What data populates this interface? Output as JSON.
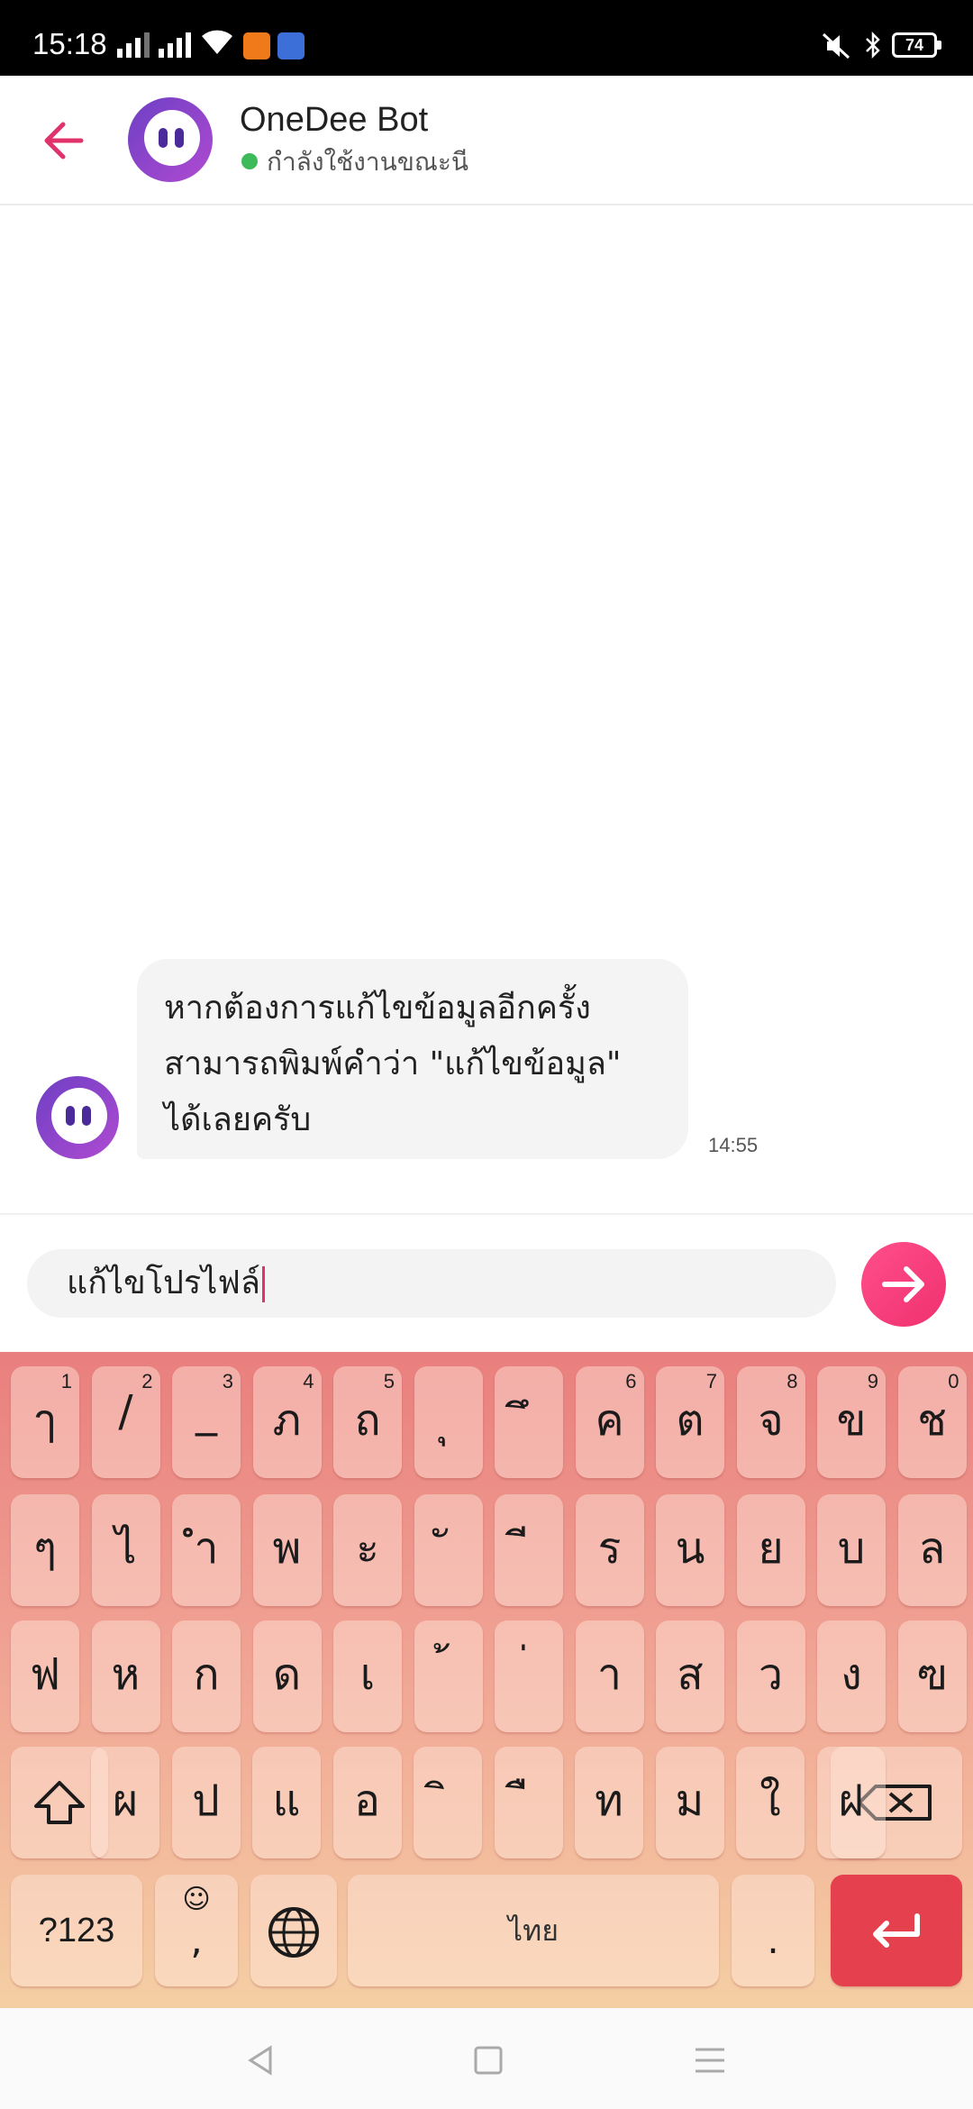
{
  "status_bar": {
    "time": "15:18",
    "battery": "74",
    "icons": [
      "signal-icon",
      "signal-icon",
      "wifi-icon",
      "app-notification-icon",
      "app-notification-icon",
      "mute-icon",
      "bluetooth-icon",
      "battery-icon"
    ]
  },
  "header": {
    "bot_name": "OneDee Bot",
    "status_text": "กำลังใช้งานขณะนี",
    "status_color": "#3dbb5a",
    "accent": "#e0336b"
  },
  "chat": {
    "messages": [
      {
        "lines": [
          "หากต้องการแก้ไขข้อมูลอีกครั้ง",
          "สามารถพิมพ์คำว่า \"แก้ไขข้อมูล\"",
          "ได้เลยครับ"
        ],
        "time": "14:55"
      }
    ]
  },
  "input": {
    "value": "แก้ไขโปรไฟล์"
  },
  "keyboard": {
    "row1": [
      {
        "key": "ๅ",
        "hint": "1"
      },
      {
        "key": "/",
        "hint": "2"
      },
      {
        "key": "_",
        "hint": "3"
      },
      {
        "key": "ภ",
        "hint": "4"
      },
      {
        "key": "ถ",
        "hint": "5"
      },
      {
        "key": "ุ",
        "hint": ""
      },
      {
        "key": "ึ",
        "hint": ""
      },
      {
        "key": "ค",
        "hint": "6"
      },
      {
        "key": "ต",
        "hint": "7"
      },
      {
        "key": "จ",
        "hint": "8"
      },
      {
        "key": "ข",
        "hint": "9"
      },
      {
        "key": "ช",
        "hint": "0"
      }
    ],
    "row2": [
      "ๆ",
      "ไ",
      "ำ",
      "พ",
      "ะ",
      "ั",
      "ี",
      "ร",
      "น",
      "ย",
      "บ",
      "ล"
    ],
    "row3": [
      "ฟ",
      "ห",
      "ก",
      "ด",
      "เ",
      "้",
      "่",
      "า",
      "ส",
      "ว",
      "ง",
      "ฃ"
    ],
    "row4": [
      "ผ",
      "ป",
      "แ",
      "อ",
      "ิ",
      "ื",
      "ท",
      "ม",
      "ใ",
      "ฝ"
    ],
    "symbols_label": "?123",
    "emoji_hint": "☺",
    "comma": ",",
    "space_label": "ไทย",
    "period": "."
  }
}
